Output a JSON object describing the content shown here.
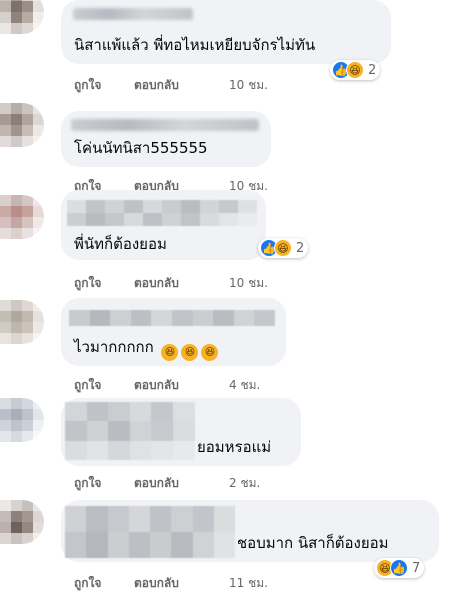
{
  "actions": {
    "like": "ถูกใจ",
    "reply": "ตอบกลับ"
  },
  "comments": [
    {
      "text": "นิสาแพ้แล้ว พี่ทอไหมเหยียบจักรไม่ทัน",
      "time": "10 ชม.",
      "reaction_count": "2",
      "reactions": [
        "like-icon",
        "haha-icon"
      ]
    },
    {
      "text": "โค่นนัทนิสา555555",
      "time": "10 ชม."
    },
    {
      "text": "พี่นัทก็ต้องยอม",
      "time": "10 ชม.",
      "reaction_count": "2",
      "reactions": [
        "like-icon",
        "haha-icon"
      ]
    },
    {
      "text": "ไวมากกกกก",
      "time": "4 ชม.",
      "emojis": [
        "laugh-emoji",
        "laugh-emoji",
        "laugh-emoji"
      ]
    },
    {
      "text": "ยอมหรอแม่",
      "time": "2 ชม."
    },
    {
      "text": "ชอบมาก นิสาก็ต้องยอม",
      "time": "11 ชม.",
      "reaction_count": "7",
      "reactions": [
        "haha-icon",
        "like-icon"
      ]
    }
  ],
  "colors": {
    "bubble": "#f0f2f5",
    "meta_text": "#65676b",
    "like_blue": "#1877f2",
    "haha_yellow": "#f7b125"
  }
}
